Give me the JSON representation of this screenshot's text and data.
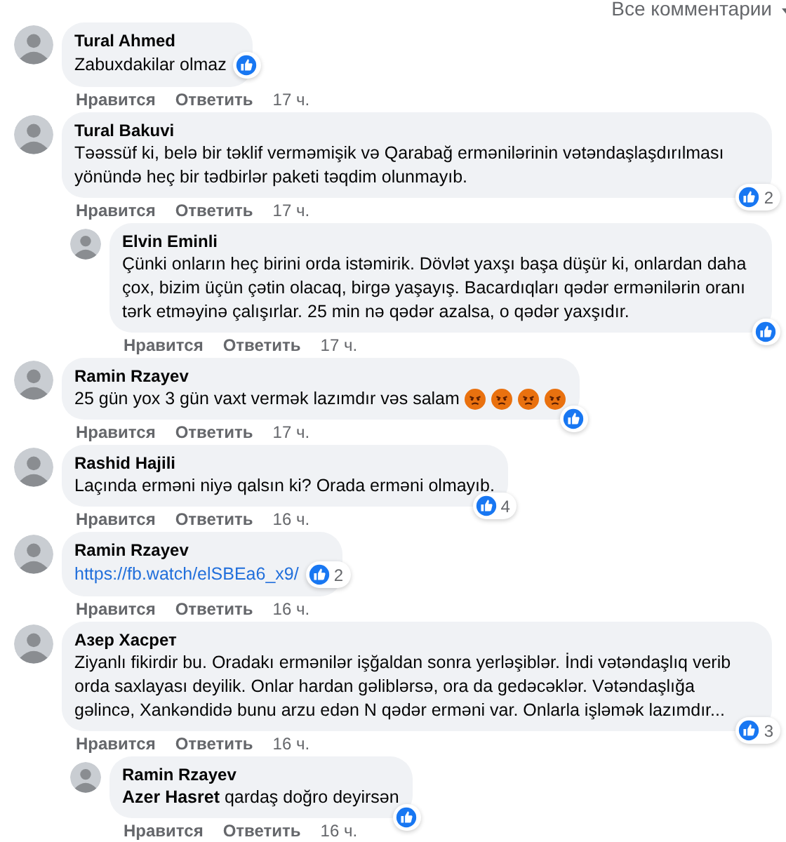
{
  "header": {
    "filter": "Все комментарии"
  },
  "comments": [
    {
      "kind": "comment",
      "author": "Tural Ahmed",
      "text": "Zabuxdakilar olmaz",
      "reaction": {
        "kind": "side"
      },
      "actions": {
        "like": "Нравится",
        "reply": "Ответить",
        "time": "17 ч."
      }
    },
    {
      "kind": "comment",
      "author": "Tural Bakuvi",
      "text": "Təəssüf ki, belə bir təklif verməmişik və Qarabağ ermənilərinin vətəndaşlaşdırılması yönündə heç bir tədbirlər paketi təqdim olunmayıb.",
      "reaction": {
        "kind": "corner",
        "count": "2"
      },
      "actions": {
        "like": "Нравится",
        "reply": "Ответить",
        "time": "17 ч."
      }
    },
    {
      "kind": "reply",
      "author": "Elvin Eminli",
      "text": "Çünki onların heç birini orda istəmirik. Dövlət yaxşı başa düşür ki, onlardan daha çox, bizim üçün çətin olacaq, birgə yaşayış. Bacardıqları qədər ermənilərin oranı tərk etməyinə çalışırlar. 25 min nə qədər azalsa, o qədər yaxşıdır.",
      "reaction": {
        "kind": "corner"
      },
      "actions": {
        "like": "Нравится",
        "reply": "Ответить",
        "time": "17 ч."
      }
    },
    {
      "kind": "comment",
      "author": "Ramin Rzayev",
      "text": "25 gün yox 3 gün vaxt vermək lazımdır vəs salam",
      "emojis": [
        {
          "kind": "angry"
        },
        {
          "kind": "angry"
        },
        {
          "kind": "angry"
        },
        {
          "kind": "angry"
        }
      ],
      "reaction": {
        "kind": "corner"
      },
      "actions": {
        "like": "Нравится",
        "reply": "Ответить",
        "time": "17 ч."
      }
    },
    {
      "kind": "comment",
      "author": "Rashid Hajili",
      "text": "Laçında erməni niyə qalsın ki? Orada erməni olmayıb.",
      "reaction": {
        "kind": "corner",
        "count": "4"
      },
      "actions": {
        "like": "Нравится",
        "reply": "Ответить",
        "time": "16 ч."
      }
    },
    {
      "kind": "comment",
      "author": "Ramin Rzayev",
      "link": "https://fb.watch/elSBEa6_x9/",
      "reaction": {
        "kind": "side",
        "count": "2"
      },
      "actions": {
        "like": "Нравится",
        "reply": "Ответить",
        "time": "16 ч."
      }
    },
    {
      "kind": "comment",
      "author": "Азер Хасрет",
      "text": "Ziyanlı fikirdir bu. Oradakı ermənilər işğaldan sonra yerləşiblər. İndi vətəndaşlıq verib orda saxlayası deyilik. Onlar hardan gəliblərsə, ora da gedəcəklər. Vətəndaşlığa gəlincə, Xankəndidə bunu arzu edən N qədər erməni var. Onlarla işləmək lazımdır...",
      "reaction": {
        "kind": "corner",
        "count": "3"
      },
      "actions": {
        "like": "Нравится",
        "reply": "Ответить",
        "time": "16 ч."
      }
    },
    {
      "kind": "reply",
      "author": "Ramin Rzayev",
      "text": "**Azer Hasret** qardaş doğro deyirsən",
      "reaction": {
        "kind": "corner"
      },
      "actions": {
        "like": "Нравится",
        "reply": "Ответить",
        "time": "16 ч."
      }
    }
  ]
}
